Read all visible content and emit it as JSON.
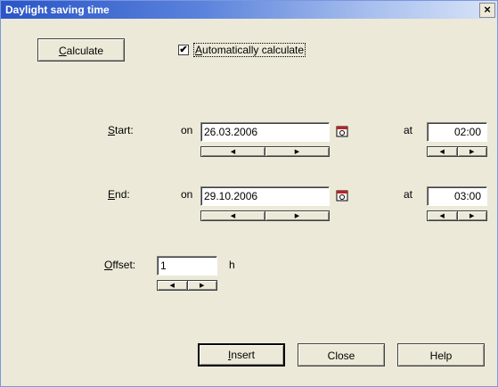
{
  "window": {
    "title": "Daylight saving time",
    "close_glyph": "×"
  },
  "calculate": {
    "label_u": "C",
    "label_rest": "alculate"
  },
  "auto_calc": {
    "checked_glyph": "✔",
    "label_u": "A",
    "label_rest": "utomatically calculate"
  },
  "start": {
    "label_u": "S",
    "label_rest": "tart:",
    "on": "on",
    "date": "26.03.2006",
    "at": "at",
    "time": "02:00"
  },
  "end": {
    "label_u": "E",
    "label_rest": "nd:",
    "on": "on",
    "date": "29.10.2006",
    "at": "at",
    "time": "03:00"
  },
  "offset": {
    "label_u": "O",
    "label_rest": "ffset:",
    "value": "1",
    "unit": "h"
  },
  "buttons": {
    "insert_u": "I",
    "insert_rest": "nsert",
    "close": "Close",
    "help": "Help"
  },
  "icons": {
    "left_arrow": "◀",
    "right_arrow": "▶",
    "calendar": "calendar-icon"
  },
  "colors": {
    "title_bar": "#2a55c6",
    "dialog_bg": "#ece9d8"
  }
}
